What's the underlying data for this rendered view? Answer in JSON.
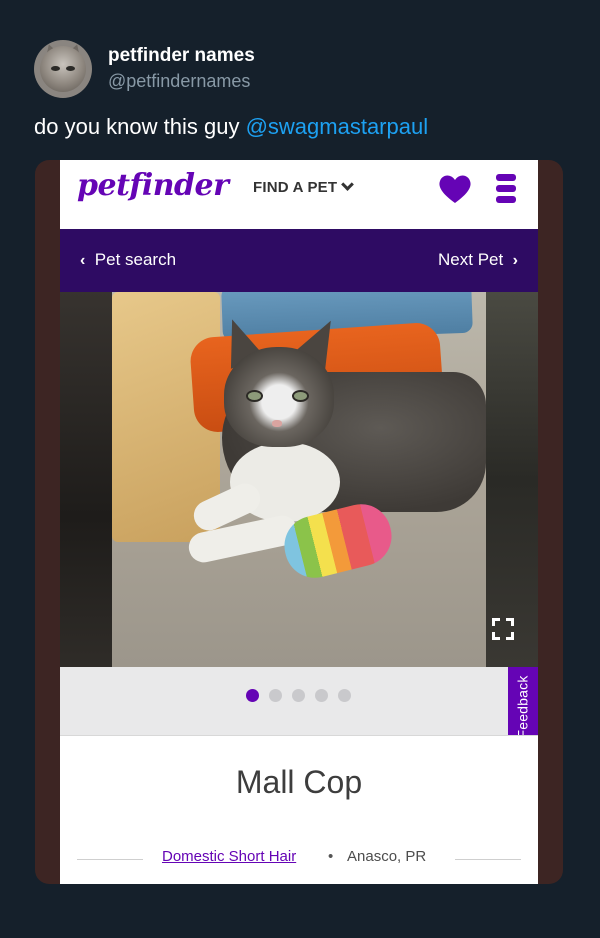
{
  "tweet": {
    "display_name": "petfinder names",
    "handle": "@petfindernames",
    "text": "do you know this guy ",
    "mention": "@swagmastarpaul"
  },
  "petfinder": {
    "logo": "petfinder",
    "find_a_pet": "FIND A PET",
    "nav": {
      "prev_arrow": "‹",
      "prev_label": "Pet search",
      "next_label": "Next Pet",
      "next_arrow": "›"
    },
    "gallery": {
      "dot_count": 5,
      "active_index": 0
    },
    "feedback": "Feedback",
    "pet": {
      "name": "Mall Cop",
      "breed": "Domestic Short Hair",
      "separator": "•",
      "location": "Anasco, PR"
    }
  },
  "colors": {
    "background": "#15202b",
    "mention": "#1da1f2",
    "brand_purple": "#6504b5",
    "nav_purple": "#2e0b63"
  }
}
